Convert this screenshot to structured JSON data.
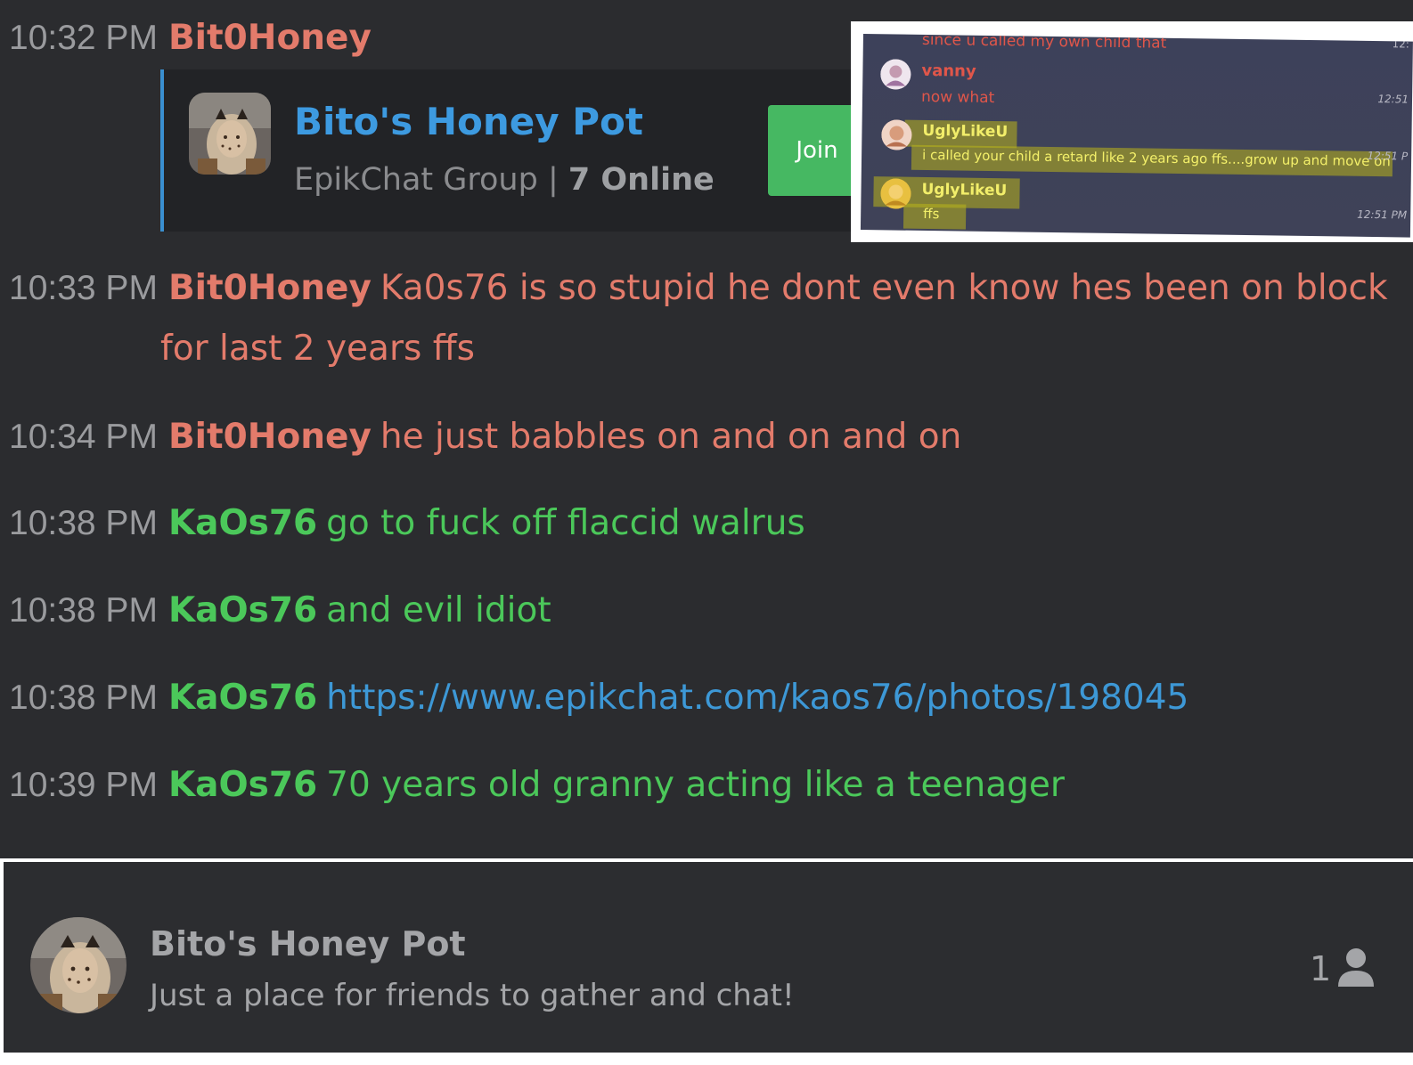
{
  "messages": [
    {
      "time": "10:32 PM",
      "user": "Bit0Honey",
      "text": "",
      "color": "#e37b6b"
    },
    {
      "time": "10:33 PM",
      "user": "Bit0Honey",
      "text": "Ka0s76 is so stupid he dont even know hes been on block for last 2 years ffs",
      "color": "#e37b6b"
    },
    {
      "time": "10:34 PM",
      "user": "Bit0Honey",
      "text": "he just babbles on and on and on",
      "color": "#e37b6b"
    },
    {
      "time": "10:38 PM",
      "user": "KaOs76",
      "text": "go to fuck off flaccid walrus",
      "color": "#4bc85a"
    },
    {
      "time": "10:38 PM",
      "user": "KaOs76",
      "text": "and evil idiot",
      "color": "#4bc85a"
    },
    {
      "time": "10:38 PM",
      "user": "KaOs76",
      "text": "https://www.epikchat.com/kaos76/photos/198045",
      "color": "#4bc85a"
    },
    {
      "time": "10:39 PM",
      "user": "KaOs76",
      "text": "70 years old granny acting like a teenager",
      "color": "#4bc85a"
    }
  ],
  "invite_card": {
    "name": "Bito's Honey Pot",
    "group_type": "EpikChat Group",
    "separator": "|",
    "online": "7 Online",
    "join_label": "Join",
    "accent": "#3a8fd0"
  },
  "inset_screenshot": {
    "top_text": "since u called my own child that",
    "rows": [
      {
        "user": "vanny",
        "text": "now what",
        "time": "12:51"
      },
      {
        "user": "UglyLikeU",
        "text": "i called your child a retard like 2 years ago ffs....grow up and move on",
        "time": "12:51 P"
      },
      {
        "user": "UglyLikeU",
        "text": "ffs",
        "time": "12:51 PM"
      }
    ],
    "corner_time": "12:"
  },
  "group_bar": {
    "name": "Bito's Honey Pot",
    "description": "Just a place for friends to gather and chat!",
    "member_count": "1",
    "icon": "person-icon"
  }
}
